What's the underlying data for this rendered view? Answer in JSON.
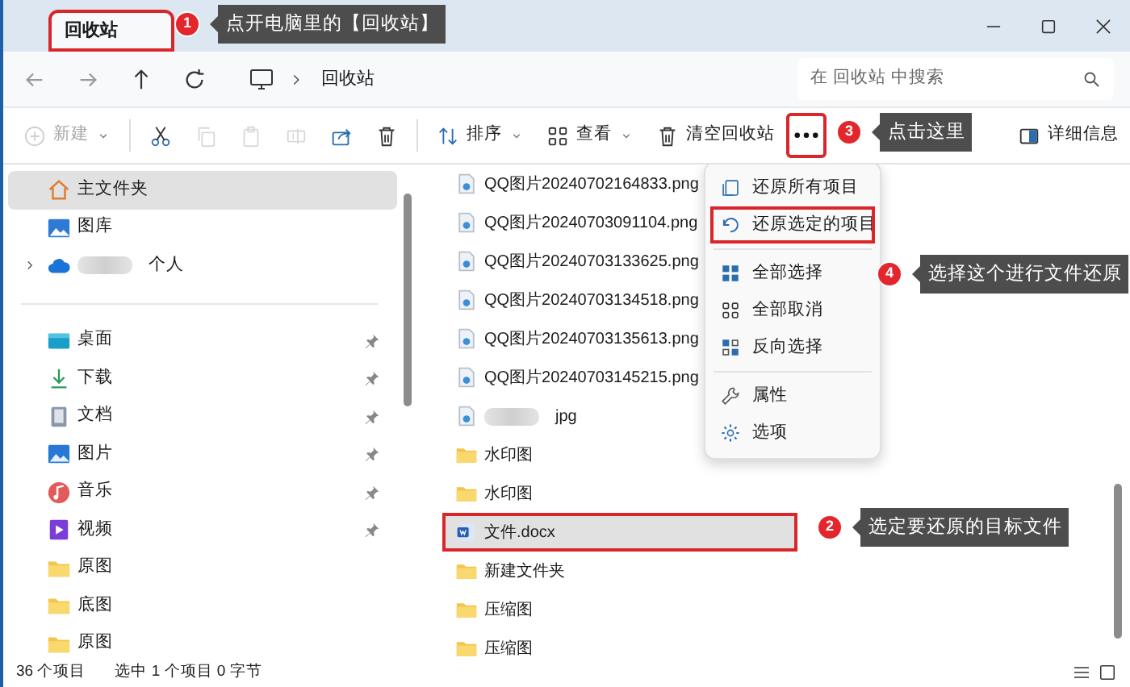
{
  "title_bar": {
    "tab": {
      "label": "回收站",
      "selected": true,
      "highlighted": true
    }
  },
  "address_bar": {
    "path": [
      "回收站"
    ],
    "search": {
      "placeholder": "在 回收站 中搜索"
    }
  },
  "toolbar": {
    "items": [
      {
        "label": "新建",
        "disabled": true,
        "dropdown": true,
        "highlighted": false
      },
      {
        "disabled": false,
        "highlighted": false
      },
      {
        "disabled": true,
        "highlighted": false
      },
      {
        "disabled": true,
        "highlighted": false
      },
      {
        "disabled": true,
        "highlighted": false
      },
      {
        "disabled": false,
        "highlighted": false
      },
      {
        "disabled": false,
        "highlighted": false
      },
      {
        "label": "排序",
        "disabled": false,
        "dropdown": true,
        "highlighted": false
      },
      {
        "label": "查看",
        "disabled": false,
        "dropdown": true,
        "highlighted": false
      },
      {
        "label": "清空回收站",
        "disabled": false,
        "highlighted": false
      },
      {
        "disabled": false,
        "highlighted": true
      },
      {
        "label": "详细信息",
        "disabled": false,
        "highlighted": false
      }
    ]
  },
  "sidebar": {
    "top_items": [
      {
        "label": "主文件夹",
        "selected": true
      },
      {
        "label": "图库",
        "selected": false
      },
      {
        "label": "个人",
        "selected": false,
        "expandable": true,
        "redacted": true
      }
    ],
    "quick_access": [
      {
        "label": "桌面",
        "selected": false,
        "pinned": true
      },
      {
        "label": "下载",
        "selected": false,
        "pinned": true
      },
      {
        "label": "文档",
        "selected": false,
        "pinned": true
      },
      {
        "label": "图片",
        "selected": false,
        "pinned": true
      },
      {
        "label": "音乐",
        "selected": false,
        "pinned": true
      },
      {
        "label": "视频",
        "selected": false,
        "pinned": true
      },
      {
        "label": "原图",
        "selected": false,
        "pinned": false
      },
      {
        "label": "底图",
        "selected": false,
        "pinned": false
      },
      {
        "label": "原图",
        "selected": false,
        "pinned": false
      }
    ]
  },
  "files": [
    {
      "name": "QQ图片20240702164833.png",
      "kind": "image",
      "selected": false,
      "highlighted": false
    },
    {
      "name": "QQ图片20240703091104.png",
      "kind": "image",
      "selected": false,
      "highlighted": false
    },
    {
      "name": "QQ图片20240703133625.png",
      "kind": "image",
      "selected": false,
      "highlighted": false
    },
    {
      "name": "QQ图片20240703134518.png",
      "kind": "image",
      "selected": false,
      "highlighted": false
    },
    {
      "name": "QQ图片20240703135613.png",
      "kind": "image",
      "selected": false,
      "highlighted": false
    },
    {
      "name": "QQ图片20240703145215.png",
      "kind": "image",
      "selected": false,
      "highlighted": false
    },
    {
      "name": "jpg",
      "kind": "image",
      "selected": false,
      "highlighted": false,
      "redacted": true
    },
    {
      "name": "水印图",
      "kind": "folder",
      "selected": false,
      "highlighted": false
    },
    {
      "name": "水印图",
      "kind": "folder",
      "selected": false,
      "highlighted": false
    },
    {
      "name": "文件.docx",
      "kind": "document",
      "selected": true,
      "highlighted": true
    },
    {
      "name": "新建文件夹",
      "kind": "folder",
      "selected": false,
      "highlighted": false
    },
    {
      "name": "压缩图",
      "kind": "folder",
      "selected": false,
      "highlighted": false
    },
    {
      "name": "压缩图",
      "kind": "folder",
      "selected": false,
      "highlighted": false
    }
  ],
  "context_menu": {
    "groups": [
      [
        {
          "label": "还原所有项目",
          "highlighted": false
        },
        {
          "label": "还原选定的项目",
          "highlighted": true
        }
      ],
      [
        {
          "label": "全部选择",
          "highlighted": false
        },
        {
          "label": "全部取消",
          "highlighted": false
        },
        {
          "label": "反向选择",
          "highlighted": false
        }
      ],
      [
        {
          "label": "属性",
          "highlighted": false
        },
        {
          "label": "选项",
          "highlighted": false
        }
      ]
    ]
  },
  "status_bar": {
    "item_count": "36 个项目",
    "selection": "选中 1 个项目 0 字节"
  },
  "annotations": [
    {
      "number": "1",
      "text": "点开电脑里的【回收站】"
    },
    {
      "number": "3",
      "text": "点击这里"
    },
    {
      "number": "4",
      "text": "选择这个进行文件还原"
    },
    {
      "number": "2",
      "text": "选定要还原的目标文件"
    }
  ]
}
